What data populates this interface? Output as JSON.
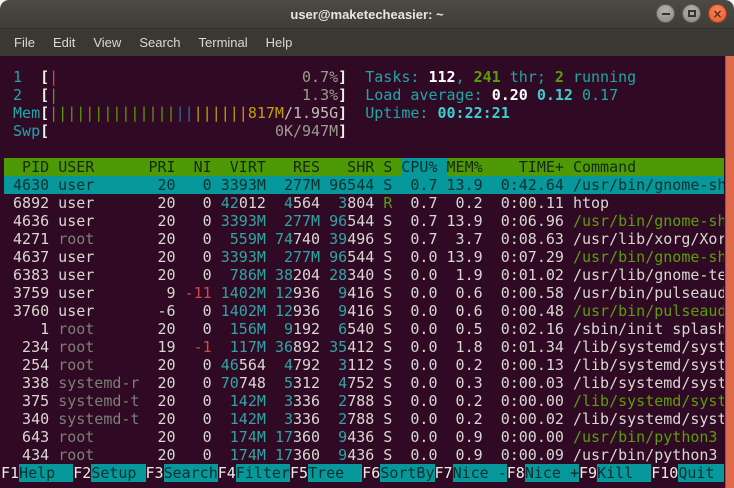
{
  "window": {
    "title": "user@maketecheasier: ~",
    "buttons": {
      "close_glyph": "×"
    }
  },
  "menu": {
    "items": [
      "File",
      "Edit",
      "View",
      "Search",
      "Terminal",
      "Help"
    ]
  },
  "htop": {
    "meters": {
      "cpu1": {
        "label": "1",
        "bar_color": "red",
        "bar_count": 1,
        "value": "0.7%"
      },
      "cpu2": {
        "label": "2",
        "bar_color": "green",
        "bar_count": 1,
        "value": "1.3%"
      },
      "mem": {
        "label": "Mem",
        "bars": {
          "green": 14,
          "blue": 2,
          "yellow": 6
        },
        "used": "817M",
        "total": "1.95G"
      },
      "swp": {
        "label": "Swp",
        "value": "0K/947M"
      }
    },
    "summary": {
      "tasks": {
        "label": "Tasks: ",
        "count": "112",
        "sep": ", ",
        "threads": "241",
        "threads_label": " thr; ",
        "running": "2",
        "running_label": " running"
      },
      "load": {
        "label": "Load average: ",
        "one": "0.20",
        "five": "0.12",
        "fifteen": "0.17"
      },
      "uptime": {
        "label": "Uptime: ",
        "value": "00:22:21"
      }
    },
    "table": {
      "columns": [
        {
          "id": "pid",
          "label": "PID",
          "w": 5,
          "align": "r"
        },
        {
          "id": "user",
          "label": "USER",
          "w": 9,
          "align": "l"
        },
        {
          "id": "pri",
          "label": "PRI",
          "w": 3,
          "align": "r"
        },
        {
          "id": "ni",
          "label": "NI",
          "w": 3,
          "align": "r"
        },
        {
          "id": "virt",
          "label": "VIRT",
          "w": 5,
          "align": "r"
        },
        {
          "id": "res",
          "label": "RES",
          "w": 5,
          "align": "r"
        },
        {
          "id": "shr",
          "label": "SHR",
          "w": 5,
          "align": "r"
        },
        {
          "id": "s",
          "label": "S",
          "w": 1,
          "align": "l"
        },
        {
          "id": "cpu",
          "label": "CPU%",
          "w": 4,
          "align": "r",
          "sort": true
        },
        {
          "id": "mem",
          "label": "MEM%",
          "w": 4,
          "align": "r"
        },
        {
          "id": "time",
          "label": "TIME+",
          "w": 8,
          "align": "r"
        },
        {
          "id": "cmd",
          "label": "Command",
          "w": 17,
          "align": "l"
        }
      ],
      "rows": [
        {
          "pid": "4630",
          "user": "user",
          "pri": "20",
          "ni": "0",
          "virt": "3393M",
          "res": "277M",
          "shr": "96544",
          "s": "S",
          "cpu": "0.7",
          "mem": "13.9",
          "time": "0:42.64",
          "cmd": "/usr/bin/gnome-sh",
          "selected": true,
          "thread": false
        },
        {
          "pid": "6892",
          "user": "user",
          "pri": "20",
          "ni": "0",
          "virt": "42012",
          "res": "4564",
          "shr": "3804",
          "s": "R",
          "cpu": "0.7",
          "mem": "0.2",
          "time": "0:00.11",
          "cmd": "htop",
          "selected": false,
          "thread": false
        },
        {
          "pid": "4636",
          "user": "user",
          "pri": "20",
          "ni": "0",
          "virt": "3393M",
          "res": "277M",
          "shr": "96544",
          "s": "S",
          "cpu": "0.7",
          "mem": "13.9",
          "time": "0:06.96",
          "cmd": "/usr/bin/gnome-sh",
          "selected": false,
          "thread": true
        },
        {
          "pid": "4271",
          "user": "root",
          "pri": "20",
          "ni": "0",
          "virt": "559M",
          "res": "74740",
          "shr": "39496",
          "s": "S",
          "cpu": "0.7",
          "mem": "3.7",
          "time": "0:08.63",
          "cmd": "/usr/lib/xorg/Xor",
          "selected": false,
          "thread": false
        },
        {
          "pid": "4637",
          "user": "user",
          "pri": "20",
          "ni": "0",
          "virt": "3393M",
          "res": "277M",
          "shr": "96544",
          "s": "S",
          "cpu": "0.0",
          "mem": "13.9",
          "time": "0:07.29",
          "cmd": "/usr/bin/gnome-sh",
          "selected": false,
          "thread": true
        },
        {
          "pid": "6383",
          "user": "user",
          "pri": "20",
          "ni": "0",
          "virt": "786M",
          "res": "38204",
          "shr": "28340",
          "s": "S",
          "cpu": "0.0",
          "mem": "1.9",
          "time": "0:01.02",
          "cmd": "/usr/lib/gnome-te",
          "selected": false,
          "thread": false
        },
        {
          "pid": "3759",
          "user": "user",
          "pri": "9",
          "ni": "-11",
          "virt": "1402M",
          "res": "12936",
          "shr": "9416",
          "s": "S",
          "cpu": "0.0",
          "mem": "0.6",
          "time": "0:00.58",
          "cmd": "/usr/bin/pulseaud",
          "selected": false,
          "thread": false
        },
        {
          "pid": "3760",
          "user": "user",
          "pri": "-6",
          "ni": "0",
          "virt": "1402M",
          "res": "12936",
          "shr": "9416",
          "s": "S",
          "cpu": "0.0",
          "mem": "0.6",
          "time": "0:00.48",
          "cmd": "/usr/bin/pulseaud",
          "selected": false,
          "thread": true
        },
        {
          "pid": "1",
          "user": "root",
          "pri": "20",
          "ni": "0",
          "virt": "156M",
          "res": "9192",
          "shr": "6540",
          "s": "S",
          "cpu": "0.0",
          "mem": "0.5",
          "time": "0:02.16",
          "cmd": "/sbin/init splash",
          "selected": false,
          "thread": false
        },
        {
          "pid": "234",
          "user": "root",
          "pri": "19",
          "ni": "-1",
          "virt": "117M",
          "res": "36892",
          "shr": "35412",
          "s": "S",
          "cpu": "0.0",
          "mem": "1.8",
          "time": "0:01.34",
          "cmd": "/lib/systemd/syst",
          "selected": false,
          "thread": false
        },
        {
          "pid": "254",
          "user": "root",
          "pri": "20",
          "ni": "0",
          "virt": "46564",
          "res": "4792",
          "shr": "3112",
          "s": "S",
          "cpu": "0.0",
          "mem": "0.2",
          "time": "0:00.13",
          "cmd": "/lib/systemd/syst",
          "selected": false,
          "thread": false
        },
        {
          "pid": "338",
          "user": "systemd-r",
          "pri": "20",
          "ni": "0",
          "virt": "70748",
          "res": "5312",
          "shr": "4752",
          "s": "S",
          "cpu": "0.0",
          "mem": "0.3",
          "time": "0:00.03",
          "cmd": "/lib/systemd/syst",
          "selected": false,
          "thread": false
        },
        {
          "pid": "375",
          "user": "systemd-t",
          "pri": "20",
          "ni": "0",
          "virt": "142M",
          "res": "3336",
          "shr": "2788",
          "s": "S",
          "cpu": "0.0",
          "mem": "0.2",
          "time": "0:00.00",
          "cmd": "/lib/systemd/syst",
          "selected": false,
          "thread": true
        },
        {
          "pid": "340",
          "user": "systemd-t",
          "pri": "20",
          "ni": "0",
          "virt": "142M",
          "res": "3336",
          "shr": "2788",
          "s": "S",
          "cpu": "0.0",
          "mem": "0.2",
          "time": "0:00.02",
          "cmd": "/lib/systemd/syst",
          "selected": false,
          "thread": false
        },
        {
          "pid": "643",
          "user": "root",
          "pri": "20",
          "ni": "0",
          "virt": "174M",
          "res": "17360",
          "shr": "9436",
          "s": "S",
          "cpu": "0.0",
          "mem": "0.9",
          "time": "0:00.00",
          "cmd": "/usr/bin/python3",
          "selected": false,
          "thread": true
        },
        {
          "pid": "434",
          "user": "root",
          "pri": "20",
          "ni": "0",
          "virt": "174M",
          "res": "17360",
          "shr": "9436",
          "s": "S",
          "cpu": "0.0",
          "mem": "0.9",
          "time": "0:00.09",
          "cmd": "/usr/bin/python3",
          "selected": false,
          "thread": false
        }
      ]
    },
    "fkeys": [
      {
        "key": "F1",
        "label": "Help  "
      },
      {
        "key": "F2",
        "label": "Setup "
      },
      {
        "key": "F3",
        "label": "Search"
      },
      {
        "key": "F4",
        "label": "Filter"
      },
      {
        "key": "F5",
        "label": "Tree  "
      },
      {
        "key": "F6",
        "label": "SortBy"
      },
      {
        "key": "F7",
        "label": "Nice -"
      },
      {
        "key": "F8",
        "label": "Nice +"
      },
      {
        "key": "F9",
        "label": "Kill  "
      },
      {
        "key": "F10",
        "label": "Quit  "
      }
    ]
  },
  "theme": {
    "terminal_bg": "#300A24",
    "terminal_fg": "#D8D8D2",
    "cyan": "#1CA8A8",
    "cyan_bright": "#3BD0D0",
    "cyan_bg": "#06989A",
    "green": "#5B9E06",
    "header_bg": "#4E9A06",
    "yellow": "#C3A000",
    "blue": "#3869A6",
    "red": "#CF4A4A",
    "dim_user": "#7C7F75",
    "scrollbar_orange": "#DE6A4D",
    "titlebar_bg": "#44423C"
  }
}
